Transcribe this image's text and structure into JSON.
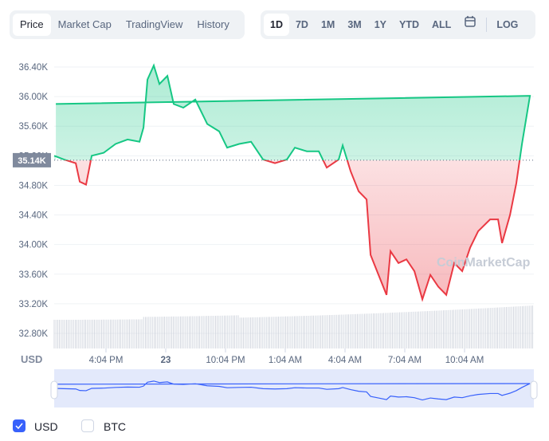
{
  "tabs": [
    "Price",
    "Market Cap",
    "TradingView",
    "History"
  ],
  "active_tab": "Price",
  "ranges": [
    "1D",
    "7D",
    "1M",
    "3M",
    "1Y",
    "YTD",
    "ALL"
  ],
  "active_range": "1D",
  "log_label": "LOG",
  "calendar_icon": "calendar-icon",
  "currency_axis_label": "USD",
  "watermark": "CoinMarketCap",
  "current_price_label": "35.14K",
  "checkboxes": [
    {
      "label": "USD",
      "checked": true
    },
    {
      "label": "BTC",
      "checked": false
    }
  ],
  "colors": {
    "up": "#16c784",
    "down": "#ea3943",
    "navigator": "#3861fb",
    "baseline_tag": "#808a9d"
  },
  "chart_data": {
    "type": "line",
    "yticks": [
      "36.40K",
      "36.00K",
      "35.60K",
      "35.20K",
      "34.80K",
      "34.40K",
      "34.00K",
      "33.60K",
      "33.20K",
      "32.80K"
    ],
    "ylim": [
      32.8,
      36.4
    ],
    "baseline": 35.14,
    "xticks": [
      "4:04 PM",
      "23",
      "10:04 PM",
      "1:04 AM",
      "4:04 AM",
      "7:04 AM",
      "10:04 AM"
    ],
    "grid": true,
    "series": [
      {
        "x": [
          "13:28",
          "13:57",
          "14:33",
          "14:45",
          "15:04",
          "15:21",
          "15:57",
          "16:33",
          "17:09",
          "17:45",
          "17:57",
          "18:09",
          "18:28",
          "18:45",
          "19:09",
          "19:28",
          "19:57",
          "20:33",
          "21:09",
          "21:45",
          "22:09",
          "22:45",
          "23:21",
          "23:57",
          "00:33",
          "01:09",
          "01:33",
          "02:09",
          "02:45",
          "03:09",
          "03:45",
          "03:57",
          "04:21",
          "04:45",
          "05:09",
          "05:21",
          "05:45",
          "06:09",
          "06:21",
          "06:45",
          "07:09",
          "07:33",
          "07:57",
          "08:21",
          "08:45",
          "09:09",
          "09:33",
          "09:57",
          "10:21",
          "10:45",
          "11:21",
          "11:45",
          "11:57",
          "12:21",
          "12:40",
          "12:57",
          "13:21",
          "13:33"
        ],
        "y": [
          35.2,
          35.15,
          35.1,
          34.85,
          34.81,
          35.2,
          35.24,
          35.36,
          35.42,
          35.39,
          35.58,
          36.23,
          36.42,
          36.17,
          36.28,
          35.9,
          35.85,
          35.96,
          35.63,
          35.53,
          35.31,
          35.36,
          35.39,
          35.15,
          35.1,
          35.15,
          35.31,
          35.26,
          35.26,
          35.04,
          35.15,
          35.34,
          34.99,
          34.72,
          34.61,
          33.86,
          33.59,
          33.32,
          33.91,
          33.75,
          33.8,
          33.64,
          33.26,
          33.59,
          33.43,
          33.32,
          33.75,
          33.64,
          33.96,
          34.18,
          34.34,
          34.34,
          34.02,
          34.4,
          34.83,
          35.36,
          36.01,
          35.9
        ]
      }
    ]
  }
}
